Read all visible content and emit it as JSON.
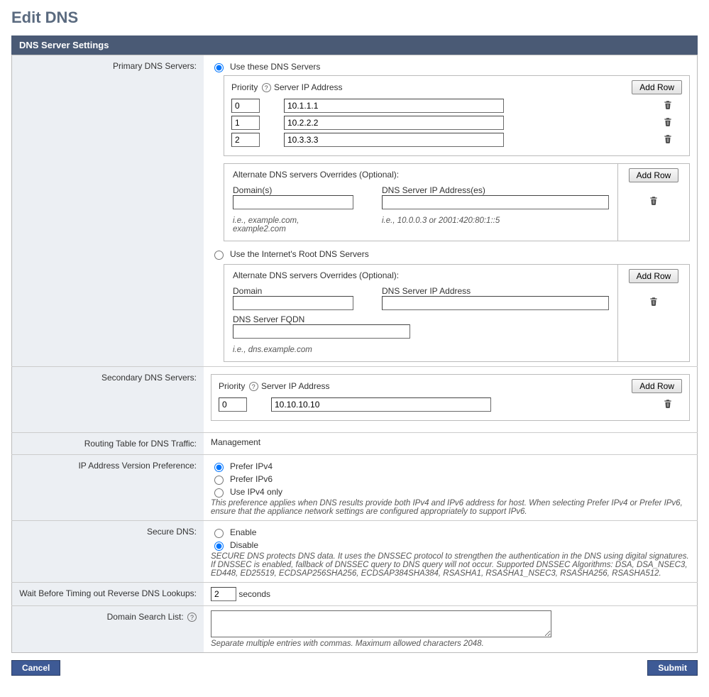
{
  "page_title": "Edit DNS",
  "section_title": "DNS Server Settings",
  "labels": {
    "primary": "Primary DNS Servers:",
    "secondary": "Secondary DNS Servers:",
    "routing": "Routing Table for DNS Traffic:",
    "ip_pref": "IP Address Version Preference:",
    "secure_dns": "Secure DNS:",
    "timeout": "Wait Before Timing out Reverse DNS Lookups:",
    "search_list": "Domain Search List:"
  },
  "radios": {
    "use_these": "Use these DNS Servers",
    "use_root": "Use the Internet's Root DNS Servers",
    "prefer_v4": "Prefer IPv4",
    "prefer_v6": "Prefer IPv6",
    "use_v4_only": "Use IPv4 only",
    "enable": "Enable",
    "disable": "Disable"
  },
  "columns": {
    "priority": "Priority",
    "server_ip": "Server IP Address",
    "domains": "Domain(s)",
    "dns_ips": "DNS Server IP Address(es)",
    "domain": "Domain",
    "dns_ip": "DNS Server IP Address",
    "fqdn": "DNS Server FQDN"
  },
  "buttons": {
    "add_row": "Add Row",
    "cancel": "Cancel",
    "submit": "Submit"
  },
  "primary_servers": [
    {
      "priority": "0",
      "ip": "10.1.1.1"
    },
    {
      "priority": "1",
      "ip": "10.2.2.2"
    },
    {
      "priority": "2",
      "ip": "10.3.3.3"
    }
  ],
  "overrides": {
    "a": {
      "title": "Alternate DNS servers Overrides (Optional):",
      "domain": "",
      "ips": "",
      "hint_domain": "i.e., example.com, example2.com",
      "hint_ips": "i.e., 10.0.0.3 or 2001:420:80:1::5"
    },
    "b": {
      "title": "Alternate DNS servers Overrides (Optional):",
      "domain": "",
      "ip": "",
      "fqdn": "",
      "hint_fqdn": "i.e., dns.example.com"
    }
  },
  "secondary_servers": [
    {
      "priority": "0",
      "ip": "10.10.10.10"
    }
  ],
  "routing_value": "Management",
  "ip_pref_note": "This preference applies when DNS results provide both IPv4 and IPv6 address for host. When selecting Prefer IPv4 or Prefer IPv6, ensure that the appliance network settings are configured appropriately to support IPv6.",
  "secure_dns_note": "SECURE DNS protects DNS data. It uses the DNSSEC protocol to strengthen the authentication in the DNS using digital signatures. If DNSSEC is enabled, fallback of DNSSEC query to DNS query will not occur. Supported DNSSEC Algorithms: DSA, DSA_NSEC3, ED448, ED25519, ECDSAP256SHA256, ECDSAP384SHA384, RSASHA1, RSASHA1_NSEC3, RSASHA256, RSASHA512.",
  "timeout_value": "2",
  "timeout_unit": "seconds",
  "search_list_value": "",
  "search_list_hint": "Separate multiple entries with commas. Maximum allowed characters 2048."
}
